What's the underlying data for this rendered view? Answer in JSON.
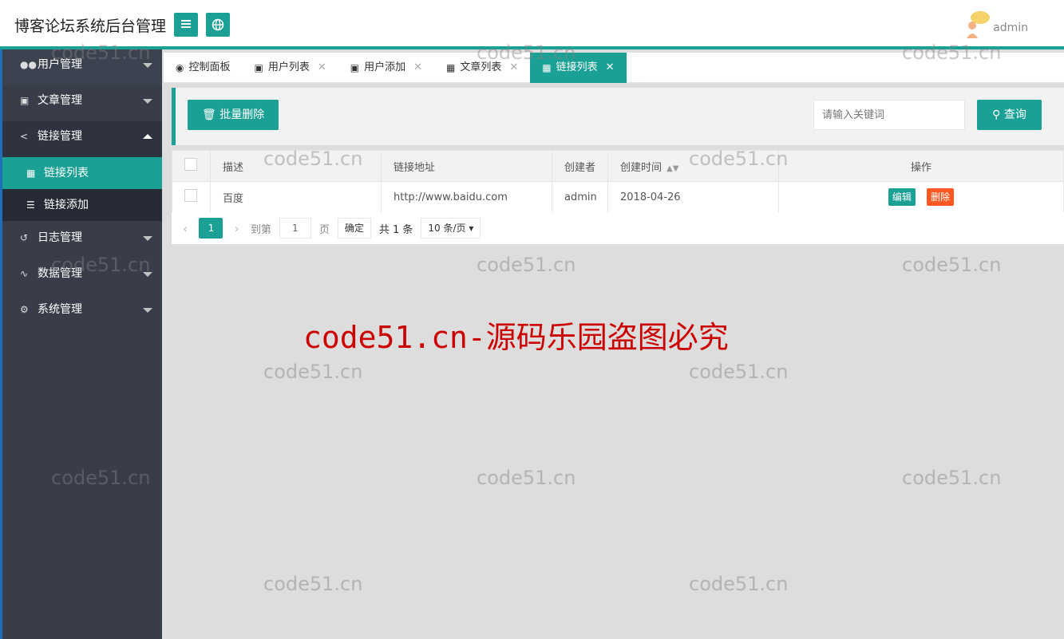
{
  "header": {
    "title": "博客论坛系统后台管理",
    "username": "admin",
    "menu_icon": "menu-icon",
    "globe_icon": "globe-icon"
  },
  "sidebar": {
    "items": [
      {
        "label": "用户管理",
        "icon": "users-icon"
      },
      {
        "label": "文章管理",
        "icon": "doc-icon"
      },
      {
        "label": "链接管理",
        "icon": "share-icon"
      },
      {
        "label": "日志管理",
        "icon": "log-icon"
      },
      {
        "label": "数据管理",
        "icon": "pulse-icon"
      },
      {
        "label": "系统管理",
        "icon": "gears-icon"
      }
    ],
    "subitems": [
      {
        "label": "链接列表",
        "icon": "grid-icon"
      },
      {
        "label": "链接添加",
        "icon": "list-icon"
      }
    ]
  },
  "tabs": [
    {
      "label": "控制面板",
      "icon": "dashboard-icon"
    },
    {
      "label": "用户列表",
      "icon": "doc-icon"
    },
    {
      "label": "用户添加",
      "icon": "doc-icon"
    },
    {
      "label": "文章列表",
      "icon": "grid-icon"
    },
    {
      "label": "链接列表",
      "icon": "grid-icon"
    }
  ],
  "toolbar": {
    "batch_delete": "批量删除",
    "search_placeholder": "请输入关键词",
    "search_button": "查询"
  },
  "table": {
    "columns": [
      "描述",
      "链接地址",
      "创建者",
      "创建时间",
      "操作"
    ],
    "rows": [
      {
        "desc": "百度",
        "url": "http://www.baidu.com",
        "creator": "admin",
        "created": "2018-04-26",
        "edit": "编辑",
        "delete": "删除"
      }
    ]
  },
  "pager": {
    "current": "1",
    "goto_label": "到第",
    "goto_value": "1",
    "page_unit": "页",
    "confirm": "确定",
    "total": "共 1 条",
    "page_size": "10 条/页"
  },
  "watermark": {
    "small": "code51.cn",
    "main": "code51.cn-源码乐园盗图必究"
  },
  "colors": {
    "accent": "#1aa094",
    "danger": "#ff5722",
    "sidebar_bg": "#393d49"
  }
}
